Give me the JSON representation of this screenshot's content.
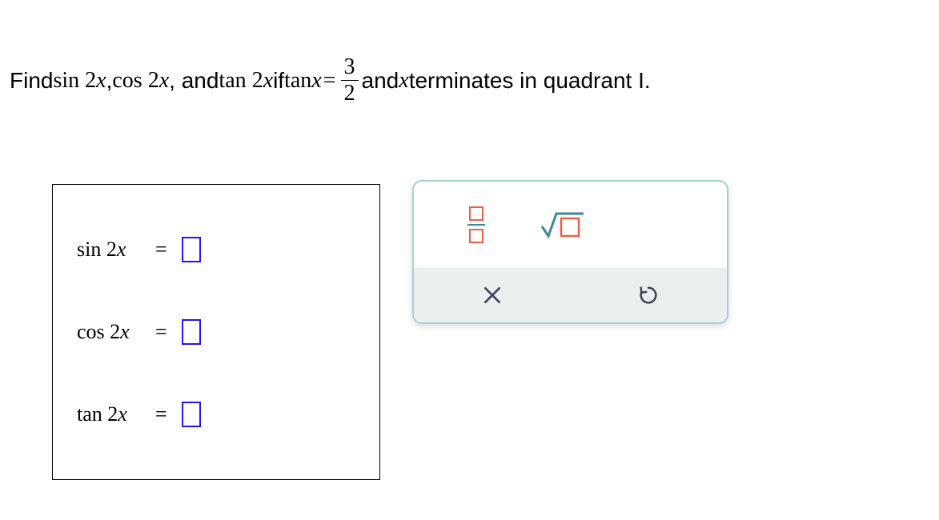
{
  "problem": {
    "prefix": "Find ",
    "s1": "sin 2",
    "v1": "x",
    "comma1": ", ",
    "s2": "cos 2",
    "v2": "x",
    "comma2": ", and ",
    "s3": "tan 2",
    "v3": "x",
    "if": " if ",
    "s4": "tan",
    "v4": "x",
    "eq": "=",
    "frac_num": "3",
    "frac_den": "2",
    "and": " and ",
    "v5": "x",
    "suffix": " terminates in quadrant I."
  },
  "answers": [
    {
      "label_fn": "sin",
      "label_arg": " 2",
      "label_var": "x",
      "eq": "="
    },
    {
      "label_fn": "cos",
      "label_arg": " 2",
      "label_var": "x",
      "eq": "="
    },
    {
      "label_fn": "tan",
      "label_arg": " 2",
      "label_var": "x",
      "eq": "="
    }
  ]
}
